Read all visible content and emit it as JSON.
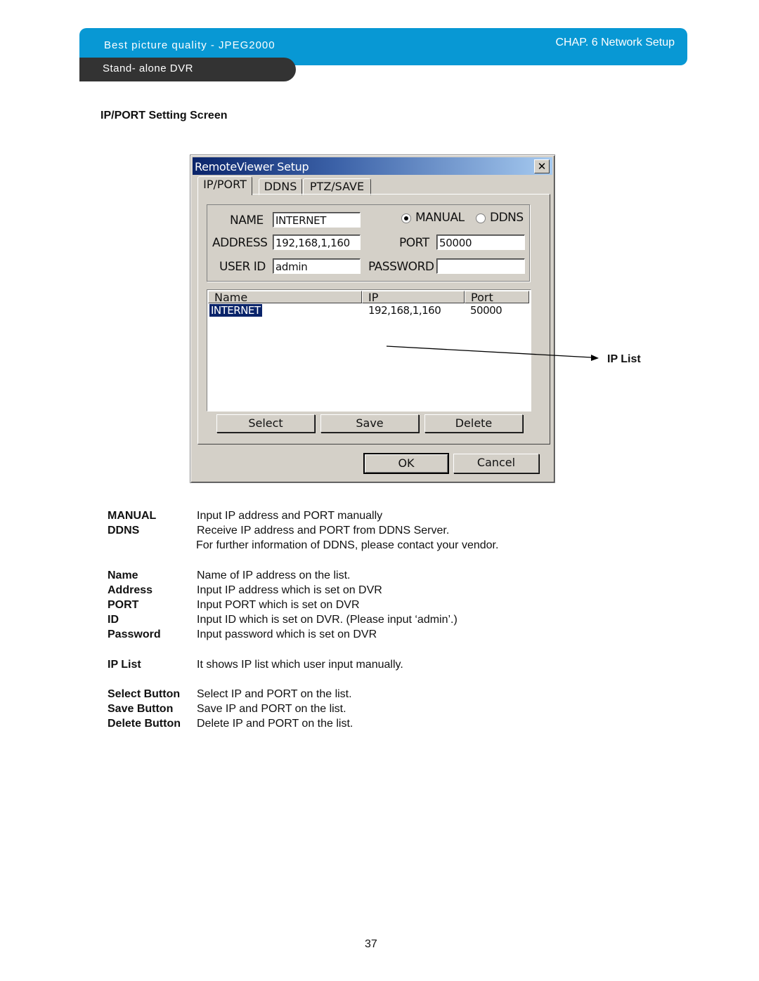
{
  "header": {
    "title": "Best picture quality - JPEG2000",
    "subtitle": "Stand- alone DVR",
    "chapter": "CHAP.  6  Network Setup",
    "colors": {
      "band": "#0898d4",
      "dark": "#333333"
    }
  },
  "section_title": "IP/PORT Setting Screen",
  "dialog": {
    "title": "RemoteViewer Setup",
    "close_icon": "close-icon",
    "tabs": [
      {
        "label": "IP/PORT",
        "active": true
      },
      {
        "label": "DDNS",
        "active": false
      },
      {
        "label": "PTZ/SAVE",
        "active": false
      }
    ],
    "form": {
      "name_label": "NAME",
      "name_value": "INTERNET",
      "address_label": "ADDRESS",
      "address_value": "192,168,1,160",
      "userid_label": "USER ID",
      "userid_value": "admin",
      "port_label": "PORT",
      "port_value": "50000",
      "password_label": "PASSWORD",
      "password_value": "",
      "mode_options": [
        {
          "label": "MANUAL",
          "selected": true
        },
        {
          "label": "DDNS",
          "selected": false
        }
      ]
    },
    "list": {
      "columns": [
        "Name",
        "IP",
        "Port"
      ],
      "rows": [
        {
          "name": "INTERNET",
          "ip": "192,168,1,160",
          "port": "50000",
          "selected": true
        }
      ]
    },
    "buttons": {
      "select": "Select",
      "save": "Save",
      "delete": "Delete",
      "ok": "OK",
      "cancel": "Cancel"
    }
  },
  "callout": {
    "label": "IP List"
  },
  "descriptions": [
    {
      "term": "MANUAL",
      "def": "Input  IP address and PORT manually"
    },
    {
      "term": "DDNS",
      "def": "Receive IP address and PORT from DDNS Server."
    },
    {
      "term": "",
      "def": "For further information of DDNS, please contact your vendor."
    },
    {
      "term": "Name",
      "def": "Name of IP address on the list."
    },
    {
      "term": "Address",
      "def": "Input IP address which is set on DVR"
    },
    {
      "term": "PORT",
      "def": "Input PORT which is set on DVR"
    },
    {
      "term": "ID",
      "def": "Input ID which is set on DVR. (Please input ‘admin’.)"
    },
    {
      "term": "Password",
      "def": "Input password which is set on DVR"
    },
    {
      "term": "IP List",
      "def": "It shows IP list which user input manually."
    },
    {
      "term": "Select Button",
      "def": "Select IP and PORT on the list."
    },
    {
      "term": "Save Button",
      "def": "Save IP and PORT on the list."
    },
    {
      "term": "Delete Button",
      "def": "Delete IP and PORT on the list."
    }
  ],
  "page_number": "37"
}
